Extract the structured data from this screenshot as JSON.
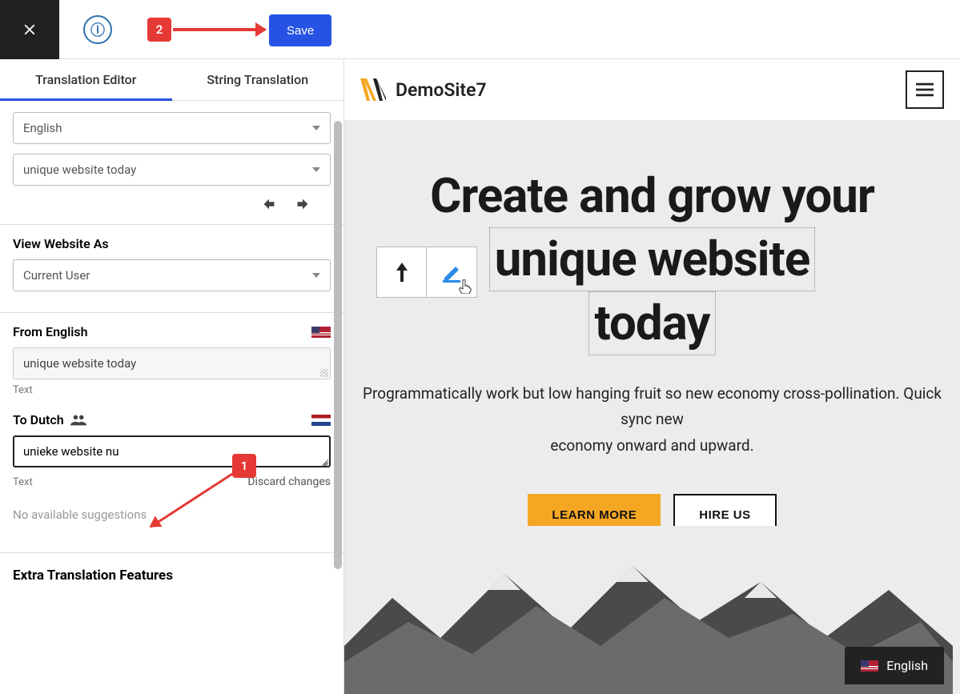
{
  "topbar": {
    "save_label": "Save",
    "step1": "1",
    "step2": "2"
  },
  "tabs": {
    "editor": "Translation Editor",
    "string": "String Translation"
  },
  "selects": {
    "language": "English",
    "string": "unique website today"
  },
  "view_as": {
    "label": "View Website As",
    "value": "Current User"
  },
  "from": {
    "label": "From English",
    "value": "unique website today",
    "type": "Text"
  },
  "to": {
    "label": "To Dutch",
    "value": "unieke website nu",
    "type": "Text",
    "discard": "Discard changes"
  },
  "suggestions": "No available suggestions",
  "extra_features": "Extra Translation Features",
  "preview": {
    "site_title": "DemoSite7",
    "hero_line1": "Create and grow your",
    "hero_line2a": "unique website",
    "hero_line3": "today",
    "sub1": "Programmatically work but low hanging fruit so new economy cross-pollination.",
    "sub2": "Quick sync new",
    "sub3": "economy onward and upward.",
    "cta_primary": "LEARN MORE",
    "cta_secondary": "HIRE US",
    "lang_switch": "English"
  }
}
